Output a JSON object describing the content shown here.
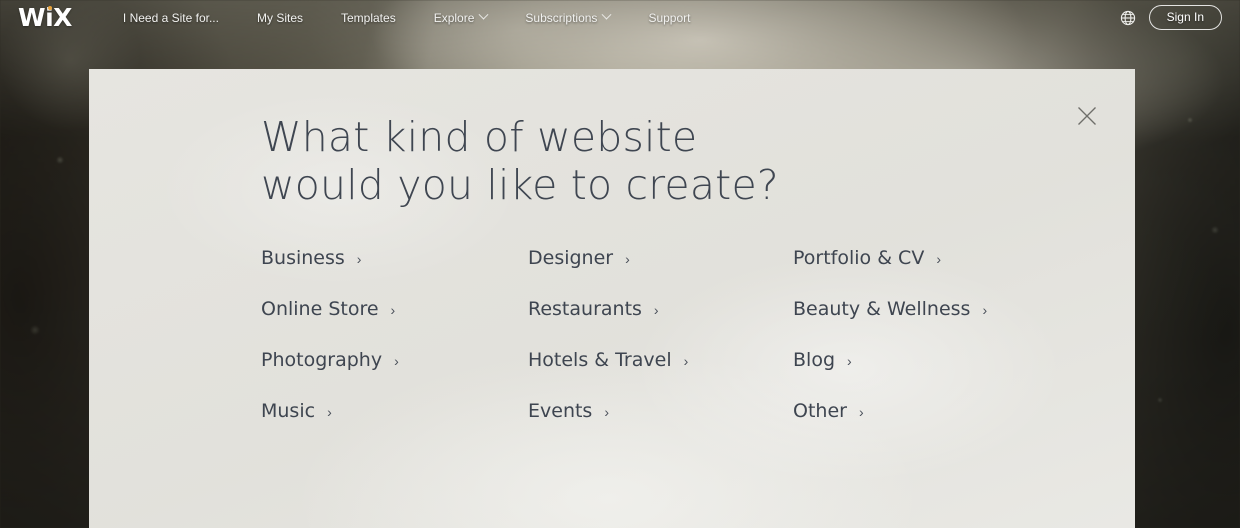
{
  "brand": {
    "logo_text": "WiX",
    "logo_dot_color": "#e8a33d"
  },
  "header": {
    "nav_items": [
      {
        "label": "I Need a Site for...",
        "has_caret": false
      },
      {
        "label": "My Sites",
        "has_caret": false
      },
      {
        "label": "Templates",
        "has_caret": false
      },
      {
        "label": "Explore",
        "has_caret": true
      },
      {
        "label": "Subscriptions",
        "has_caret": true
      },
      {
        "label": "Support",
        "has_caret": false
      }
    ],
    "language_icon": "globe-icon",
    "sign_in_label": "Sign In"
  },
  "modal": {
    "close_icon": "close-icon",
    "heading": "What kind of website\nwould you like to create?",
    "columns": [
      {
        "items": [
          {
            "label": "Business",
            "chevron": "›"
          },
          {
            "label": "Online Store",
            "chevron": "›"
          },
          {
            "label": "Photography",
            "chevron": "›"
          },
          {
            "label": "Music",
            "chevron": "›"
          }
        ]
      },
      {
        "items": [
          {
            "label": "Designer",
            "chevron": "›"
          },
          {
            "label": "Restaurants",
            "chevron": "›"
          },
          {
            "label": "Hotels & Travel",
            "chevron": "›"
          },
          {
            "label": "Events",
            "chevron": "›"
          }
        ]
      },
      {
        "items": [
          {
            "label": "Portfolio & CV",
            "chevron": "›"
          },
          {
            "label": "Beauty & Wellness",
            "chevron": "›"
          },
          {
            "label": "Blog",
            "chevron": "›"
          },
          {
            "label": "Other",
            "chevron": "›"
          }
        ]
      }
    ]
  },
  "colors": {
    "panel_background": "#e3e2dd",
    "text_dark": "#3e4550",
    "nav_text": "#f2f2f0",
    "accent": "#e8a33d"
  }
}
